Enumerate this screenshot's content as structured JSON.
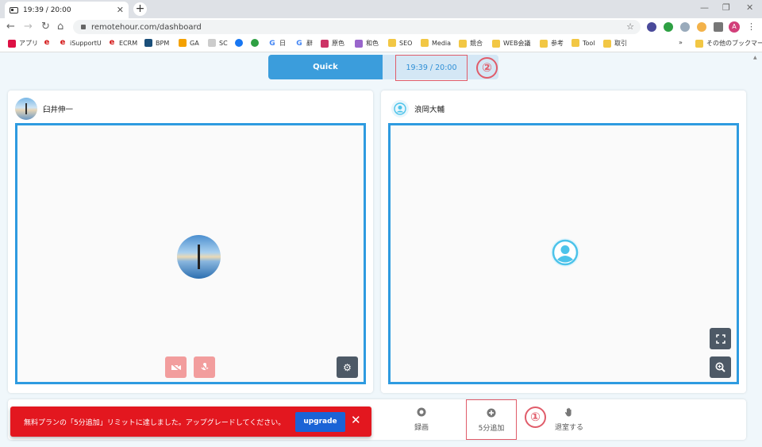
{
  "browser": {
    "tab_title": "19:39 / 20:00",
    "url": "remotehour.com/dashboard",
    "profile_initial": "A",
    "bookmarks": [
      "アプリ",
      "iSupportU",
      "ECRM",
      "BPM",
      "GA",
      "SC",
      "日",
      "辭",
      "原色",
      "和色",
      "SEO",
      "Media",
      "競合",
      "WEB会議",
      "参考",
      "Tool",
      "取引"
    ],
    "other_bookmarks": "その他のブックマーク",
    "overflow": "»"
  },
  "app": {
    "quick_tab": "Quick",
    "timer": "19:39 / 20:00",
    "annotation_timer": "②",
    "annotation_extend": "①",
    "participants": [
      {
        "name": "臼井伸一"
      },
      {
        "name": "浪岡大輔"
      }
    ],
    "actions": {
      "record": "録画",
      "extend": "5分追加",
      "leave": "退室する"
    },
    "toast": {
      "message": "無料プランの「5分追加」リミットに達しました。アップグレードしてください。",
      "button": "upgrade",
      "close": "✕"
    },
    "colors": {
      "accent": "#3b9ddc",
      "video_border": "#2e9be0",
      "error": "#e3171f",
      "upgrade": "#1a63d6",
      "annotation": "#e05c6a"
    }
  }
}
